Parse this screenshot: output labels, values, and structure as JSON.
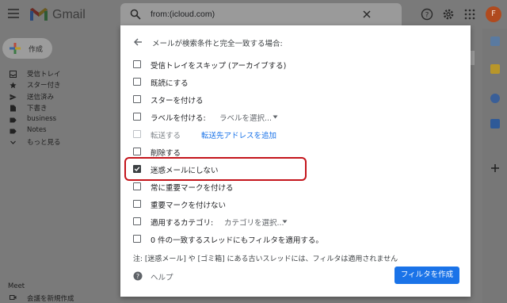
{
  "app": {
    "logo_text": "Gmail",
    "avatar_letter": "F"
  },
  "search": {
    "value": "from:(icloud.com)"
  },
  "compose": {
    "label": "作成"
  },
  "sidebar": {
    "items": [
      {
        "label": "受信トレイ",
        "icon": "inbox-icon"
      },
      {
        "label": "スター付き",
        "icon": "star-icon"
      },
      {
        "label": "送信済み",
        "icon": "send-icon"
      },
      {
        "label": "下書き",
        "icon": "draft-icon"
      },
      {
        "label": "business",
        "icon": "label-icon"
      },
      {
        "label": "Notes",
        "icon": "label-icon"
      },
      {
        "label": "もっと見る",
        "icon": "chevron-down-icon"
      }
    ],
    "meet_title": "Meet",
    "meet_item": "会議を新規作成"
  },
  "filter_dialog": {
    "title": "メールが検索条件と完全一致する場合:",
    "options": [
      {
        "label": "受信トレイをスキップ (アーカイブする)",
        "checked": false
      },
      {
        "label": "既読にする",
        "checked": false
      },
      {
        "label": "スターを付ける",
        "checked": false
      },
      {
        "label": "ラベルを付ける:",
        "select_value": "ラベルを選択...",
        "checked": false
      },
      {
        "label": "転送する",
        "link": "転送先アドレスを追加",
        "checked": false,
        "disabled": true
      },
      {
        "label": "削除する",
        "checked": false
      },
      {
        "label": "迷惑メールにしない",
        "checked": true
      },
      {
        "label": "常に重要マークを付ける",
        "checked": false
      },
      {
        "label": "重要マークを付けない",
        "checked": false
      },
      {
        "label": "適用するカテゴリ:",
        "select_value": "カテゴリを選択...",
        "checked": false
      },
      {
        "label": "0 件の一致するスレッドにもフィルタを適用する。",
        "checked": false
      }
    ],
    "note": "注: [迷惑メール] や [ゴミ箱] にある古いスレッドには、フィルタは適用されません",
    "help_label": "ヘルプ",
    "create_button": "フィルタを作成"
  },
  "colors": {
    "accent": "#1a73e8",
    "highlight": "#c4151c",
    "avatar": "#b04a1e"
  }
}
